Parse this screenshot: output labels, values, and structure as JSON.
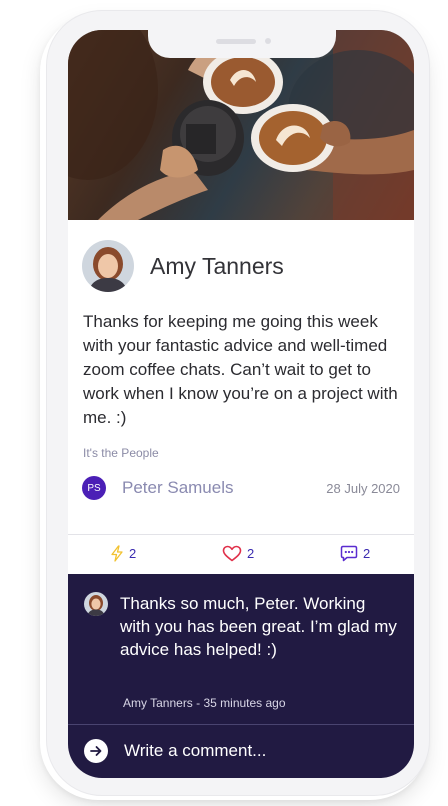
{
  "post": {
    "author_name": "Amy Tanners",
    "message": "Thanks for keeping me going this week with your fantastic advice and well-timed zoom coffee chats. Can’t wait to get to work when I know you’re on a project with me. :)",
    "tag": "It's the People",
    "sender_initials": "PS",
    "sender_name": "Peter Samuels",
    "date": "28 July 2020"
  },
  "stats": {
    "boosts": "2",
    "likes": "2",
    "comments": "2"
  },
  "comment": {
    "text": "Thanks so much, Peter. Working with you has been great. I’m glad my advice has helped! :)",
    "meta": "Amy Tanners - 35 minutes ago"
  },
  "composer": {
    "placeholder": "Write a comment..."
  },
  "colors": {
    "accent": "#4b1fb6",
    "dark_panel": "#211a42",
    "like_red": "#e0304a",
    "boost_yellow": "#f2c230"
  },
  "icons": [
    "lightning-icon",
    "heart-icon",
    "comment-bubble-icon",
    "arrow-right-icon"
  ]
}
